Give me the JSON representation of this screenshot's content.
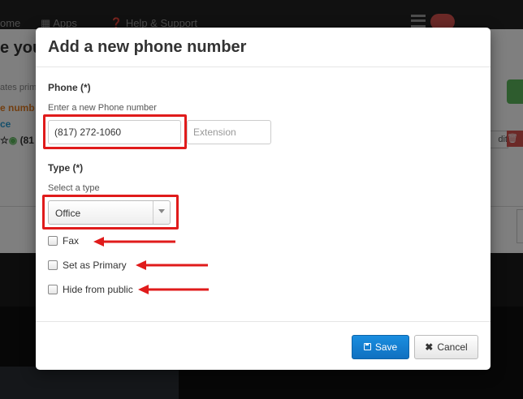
{
  "background": {
    "nav_items": [
      "ome",
      "Apps",
      "Help & Support"
    ],
    "page_title": "e you",
    "small_text": "ates prima",
    "highlight_text": "e numb",
    "link_text": "ce",
    "phone_text": "(81",
    "edit_text": "dit"
  },
  "modal": {
    "title": "Add a new phone number",
    "phone": {
      "label": "Phone (*)",
      "help": "Enter a new Phone number",
      "value": "(817) 272-1060",
      "extension_placeholder": "Extension"
    },
    "type": {
      "label": "Type (*)",
      "help": "Select a type",
      "selected": "Office"
    },
    "checkboxes": [
      {
        "label": "Fax",
        "checked": false
      },
      {
        "label": "Set as Primary",
        "checked": false
      },
      {
        "label": "Hide from public",
        "checked": false
      }
    ],
    "buttons": {
      "save": "Save",
      "cancel": "Cancel"
    }
  },
  "colors": {
    "annotation": "#e01b1b",
    "primary_button": "#1a8ee0"
  },
  "icons": {
    "save": "floppy-disk-icon",
    "cancel": "close-icon",
    "select": "chevron-down-icon"
  }
}
